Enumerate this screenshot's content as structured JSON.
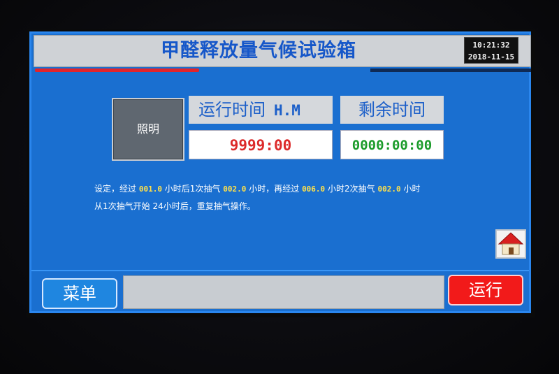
{
  "header": {
    "title": "甲醛释放量气候试验箱",
    "time": "10:21:32",
    "date": "2018-11-15"
  },
  "controls": {
    "light_label": "照明",
    "run_time_label": "运行时间",
    "run_time_unit": "H.M",
    "run_time_value": "9999:00",
    "remaining_label": "剩余时间",
    "remaining_value": "0000:00:00"
  },
  "settings": {
    "l1_a": "设定，经过",
    "l1_v1": "001.0",
    "l1_b": "小时后1次抽气",
    "l1_v2": "002.0",
    "l1_c": "小时，再经过",
    "l1_v3": "006.0",
    "l1_d": "小时2次抽气",
    "l1_v4": "002.0",
    "l1_e": "小时",
    "l2": "从1次抽气开始 24小时后，重复抽气操作。"
  },
  "footer": {
    "menu_label": "菜单",
    "run_label": "运行",
    "message": ""
  },
  "icons": {
    "home": "home-icon"
  },
  "colors": {
    "panel": "#1a6fd0",
    "title": "#1657c9",
    "run_time_value": "#dc2a2a",
    "remaining_value": "#1b9b2a",
    "highlight_numbers": "#ffe14a",
    "run_button": "#f21a1a",
    "menu_button": "#1f86e0"
  }
}
